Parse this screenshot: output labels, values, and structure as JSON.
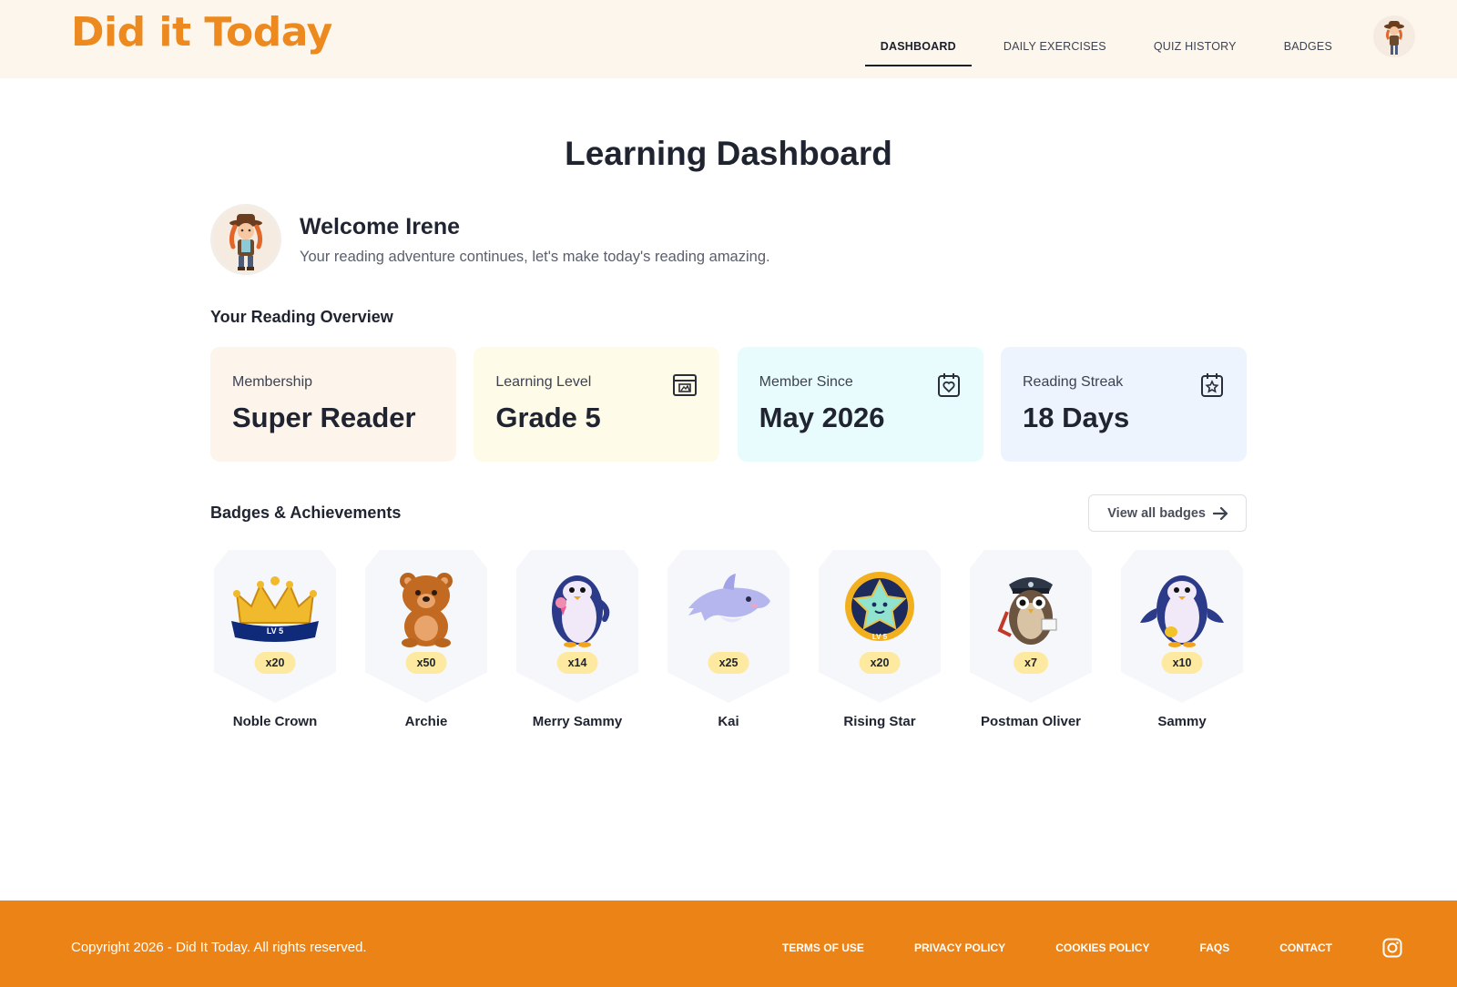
{
  "header": {
    "logo": "Did it Today",
    "nav": [
      {
        "label": "DASHBOARD",
        "active": true
      },
      {
        "label": "DAILY EXERCISES",
        "active": false
      },
      {
        "label": "QUIZ HISTORY",
        "active": false
      },
      {
        "label": "BADGES",
        "active": false
      }
    ]
  },
  "main": {
    "title": "Learning Dashboard",
    "welcome": {
      "title": "Welcome Irene",
      "subtitle": "Your reading adventure continues, let's make today's reading amazing."
    },
    "overview": {
      "title": "Your Reading Overview",
      "cards": [
        {
          "label": "Membership",
          "value": "Super Reader",
          "color": "#fdf4ec",
          "icon": "none"
        },
        {
          "label": "Learning Level",
          "value": "Grade 5",
          "color": "#fefbe9",
          "icon": "picture-calendar-icon"
        },
        {
          "label": "Member Since",
          "value": "May 2026",
          "color": "#e9fcfd",
          "icon": "heart-calendar-icon"
        },
        {
          "label": "Reading Streak",
          "value": "18 Days",
          "color": "#eef4fe",
          "icon": "star-calendar-icon"
        }
      ]
    },
    "badges": {
      "title": "Badges & Achievements",
      "view_all": "View all badges",
      "items": [
        {
          "name": "Noble Crown",
          "count": "x20",
          "art": "crown",
          "crown_label": "LV 5"
        },
        {
          "name": "Archie",
          "count": "x50",
          "art": "bear"
        },
        {
          "name": "Merry Sammy",
          "count": "x14",
          "art": "penguin-icecream"
        },
        {
          "name": "Kai",
          "count": "x25",
          "art": "dolphin"
        },
        {
          "name": "Rising Star",
          "count": "x20",
          "art": "star",
          "star_label": "LV 5"
        },
        {
          "name": "Postman Oliver",
          "count": "x7",
          "art": "owl-postman"
        },
        {
          "name": "Sammy",
          "count": "x10",
          "art": "penguin"
        }
      ]
    }
  },
  "footer": {
    "copyright": "Copyright 2026 - Did It Today. All rights reserved.",
    "links": [
      "TERMS OF USE",
      "PRIVACY POLICY",
      "COOKIES POLICY",
      "FAQS",
      "CONTACT"
    ],
    "social_icon": "instagram-icon"
  },
  "colors": {
    "accent": "#ec8a1f",
    "footer": "#ec8316",
    "header_bg": "#fdf6ec",
    "badge_count_bg": "#fde9a0"
  }
}
